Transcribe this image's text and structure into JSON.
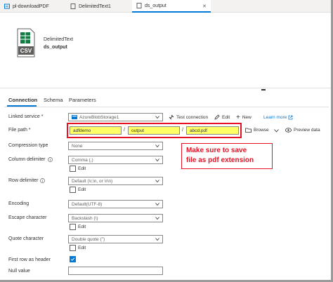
{
  "tabs": [
    {
      "label": "pl-downloadPDF",
      "active": false
    },
    {
      "label": "DelimitedText1",
      "active": false
    },
    {
      "label": "ds_output",
      "active": true
    }
  ],
  "dataset": {
    "type_label": "DelimitedText",
    "name": "ds_output",
    "icon_text": "CSV"
  },
  "property_tabs": [
    "Connection",
    "Schema",
    "Parameters"
  ],
  "form": {
    "linked_service": {
      "label": "Linked service *",
      "value": "AzureBlobStorage1"
    },
    "linked_actions": {
      "test": "Test connection",
      "edit": "Edit",
      "new": "New",
      "learn": "Learn more"
    },
    "file_path": {
      "label": "File path *",
      "container": "adfdemo",
      "directory": "output",
      "file": "abcd.pdf",
      "separator": "/"
    },
    "file_actions": {
      "browse": "Browse",
      "preview": "Preview data"
    },
    "compression_type": {
      "label": "Compression type",
      "value": "None"
    },
    "column_delimiter": {
      "label": "Column delimiter",
      "value": "Comma (,)",
      "edit": "Edit"
    },
    "row_delimiter": {
      "label": "Row delimiter",
      "value": "Default (\\r,\\n, or \\r\\n)",
      "edit": "Edit"
    },
    "encoding": {
      "label": "Encoding",
      "value": "Default(UTF-8)"
    },
    "escape_character": {
      "label": "Escape character",
      "value": "Backslash (\\)",
      "edit": "Edit"
    },
    "quote_character": {
      "label": "Quote character",
      "value": "Double quote (\")",
      "edit": "Edit"
    },
    "first_row_header": {
      "label": "First row as header",
      "checked": true
    },
    "null_value": {
      "label": "Null value",
      "value": ""
    }
  },
  "callout": {
    "line1": "Make sure to save",
    "line2": "file as pdf extension"
  },
  "colors": {
    "accent": "#0078d4",
    "highlight": "#ffff66",
    "annotation": "#e81123"
  }
}
